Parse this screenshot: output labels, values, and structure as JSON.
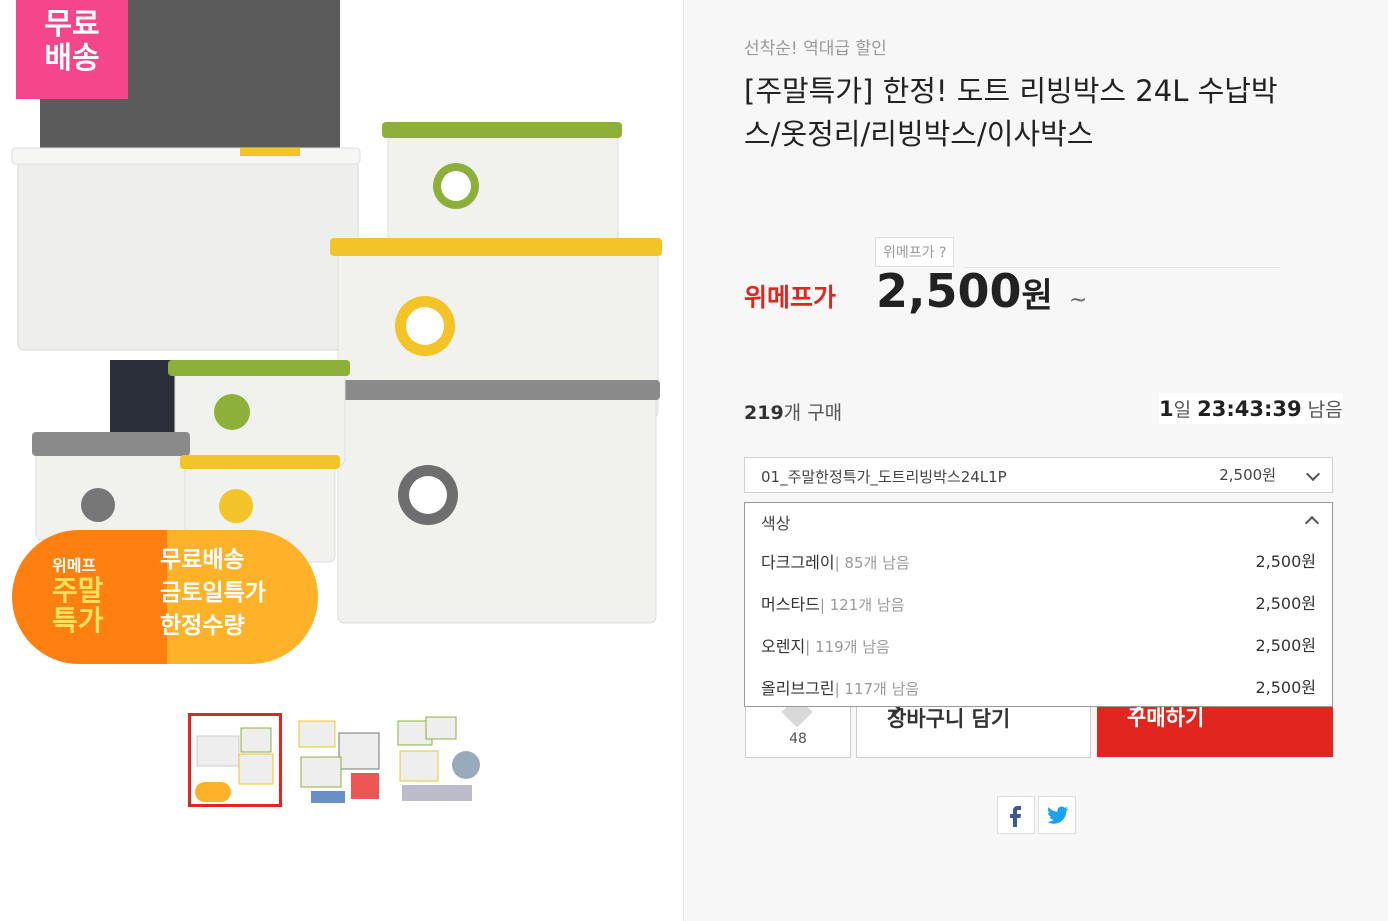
{
  "image": {
    "free_badge": "무료\n배송",
    "promo": {
      "brand": "위메프",
      "big": "주말\n특가",
      "lines": [
        "무료배송",
        "금토일특가",
        "한정수량"
      ]
    }
  },
  "product": {
    "subtitle": "선착순! 역대급 할인",
    "title": "[주말특가] 한정! 도트 리빙박스 24L 수납박스/옷정리/리빙박스/이사박스"
  },
  "price": {
    "question": "위메프가 ?",
    "label": "위메프가",
    "amount": "2,500",
    "unit": "원",
    "tilde": "~"
  },
  "stats": {
    "sold_count": "219",
    "sold_text": "개 구매",
    "days": "1",
    "days_unit": "일",
    "time": "23:43:39",
    "remain_text": "남음"
  },
  "option1": {
    "label": "01_주말한정특가_도트리빙박스24L1P",
    "price": "2,500원"
  },
  "option2": {
    "label": "색상"
  },
  "colors": [
    {
      "name": "다크그레이",
      "stock": "| 85개 남음",
      "price": "2,500원"
    },
    {
      "name": "머스타드",
      "stock": "| 121개 남음",
      "price": "2,500원"
    },
    {
      "name": "오렌지",
      "stock": "| 119개 남음",
      "price": "2,500원"
    },
    {
      "name": "올리브그린",
      "stock": "| 117개 남음",
      "price": "2,500원"
    }
  ],
  "actions": {
    "like_count": "48",
    "cart": "장바구니 담기",
    "buy": "구매하기"
  },
  "colors_theme": {
    "accent": "#e0261f",
    "badge": "#f5468c",
    "promo": "#fdb22a"
  }
}
